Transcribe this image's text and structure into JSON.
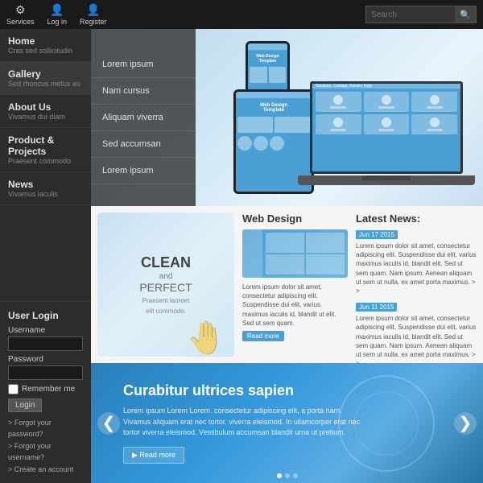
{
  "topbar": {
    "items": [
      {
        "label": "Services",
        "icon": "⚙"
      },
      {
        "label": "Log in",
        "icon": "👤"
      },
      {
        "label": "Register",
        "icon": "👤"
      }
    ],
    "search_placeholder": "Search",
    "search_button_icon": "🔍"
  },
  "nav": {
    "items": [
      {
        "title": "Home",
        "sub": "Cras sed sollicitudin",
        "active": false
      },
      {
        "title": "Gallery",
        "sub": "Sed rhoncus metus eu",
        "active": true
      },
      {
        "title": "About Us",
        "sub": "Vivamus dui diam",
        "active": false
      },
      {
        "title": "Product & Projects",
        "sub": "Praesent commodo",
        "active": false
      },
      {
        "title": "News",
        "sub": "Vivamus iaculis",
        "active": false
      }
    ]
  },
  "dropdown": {
    "items": [
      "Lorem ipsum",
      "Nam cursus",
      "Aliquam viverra",
      "Sed accumsan",
      "Lorem ipsum"
    ]
  },
  "devices": {
    "template_label": "Web Design Template"
  },
  "middle": {
    "tablet_clean": "CLEAN",
    "tablet_and": "and",
    "tablet_perfect": "PERFECT",
    "tablet_sub": "Praesent laoreet",
    "tablet_sub2": "elit commodo.",
    "web_design_title": "Web Design",
    "web_design_text": "Lorem ipsum dolor sit amet, consectetur adipiscing elit. Suspendisse dui elit, varius maximus iaculis id, blandit ut elit. Sed ut sem quam.",
    "read_more": "Read more",
    "latest_news_title": "Latest News:",
    "news_items": [
      {
        "date": "Jun 17 2015",
        "text": "Lorem ipsum dolor sit amet, consectetur adipiscing elit. Suspendisse dui elit, varius maximus iaculis id, blandit elit. Sed ut sem quam. Nam ipsum. Aenean aliquam ut sem ut nulla. ex amet porta maximus. > >"
      },
      {
        "date": "Jun 11 2015",
        "text": "Lorem ipsum dolor sit amet, consectetur adipiscing elit. Suspendisse dui elit, varius maximus iaculis id, blandit elit. Sed ut sem quam. Nam ipsum. Aenean aliquam ut sem ut nulla. ex amet porta maximus. > >"
      }
    ]
  },
  "banner": {
    "title": "Curabitur ultrices sapien",
    "text": "Lorem ipsum Lorem Lorem. consectetur adipiscing elit, a porta nam. Vivamus aliquam erat nec tortor. viverra eleismod. In ullamcorper erat nec tortor viverra eleismod. Vestibulum accumsan blandit urna ut pretium.",
    "button_label": "Read more",
    "nav_left": "❮",
    "nav_right": "❯"
  },
  "user_login": {
    "title": "User Login",
    "username_label": "Username",
    "password_label": "Password",
    "remember_label": "Remember me",
    "login_button": "Login",
    "links": [
      "Forgot your password?",
      "Forgot your username?",
      "Create an account"
    ]
  }
}
